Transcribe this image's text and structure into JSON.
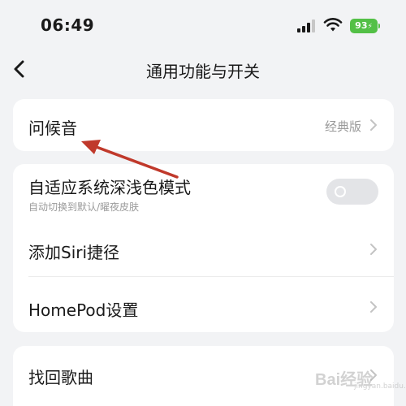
{
  "status_bar": {
    "time": "06:49",
    "battery": "93",
    "icons": [
      "signal-icon",
      "wifi-icon",
      "battery-icon"
    ],
    "battery_color": "#53c046"
  },
  "nav": {
    "title": "通用功能与开关",
    "back_icon": "chevron-left-icon"
  },
  "settings": {
    "greeting": {
      "label": "问候音",
      "value": "经典版"
    },
    "dark_mode": {
      "label": "自适应系统深浅色模式",
      "sublabel": "自动切换到默认/曜夜皮肤",
      "enabled": false
    },
    "siri": {
      "label": "添加Siri捷径"
    },
    "homepod": {
      "label": "HomePod设置"
    },
    "recover": {
      "label": "找回歌曲"
    }
  },
  "annotation": {
    "arrow_color": "#c0392b",
    "points_to": "greeting"
  },
  "watermark": {
    "text": "Bai经验",
    "sub": "jingyan.baidu.com"
  }
}
